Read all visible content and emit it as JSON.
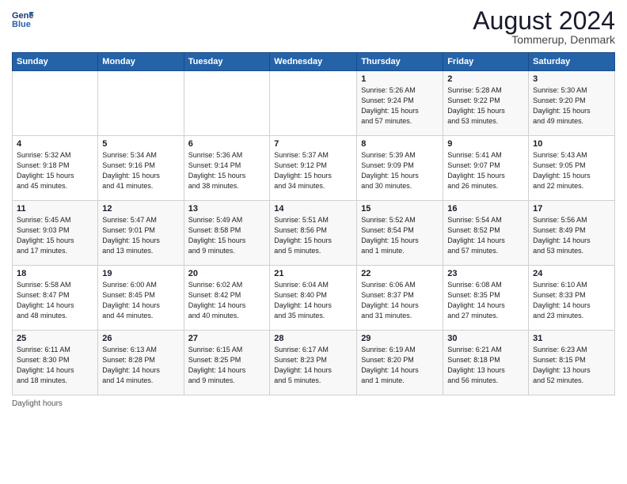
{
  "header": {
    "logo_line1": "General",
    "logo_line2": "Blue",
    "month": "August 2024",
    "location": "Tommerup, Denmark"
  },
  "weekdays": [
    "Sunday",
    "Monday",
    "Tuesday",
    "Wednesday",
    "Thursday",
    "Friday",
    "Saturday"
  ],
  "footer_text": "Daylight hours",
  "weeks": [
    [
      {
        "day": "",
        "info": ""
      },
      {
        "day": "",
        "info": ""
      },
      {
        "day": "",
        "info": ""
      },
      {
        "day": "",
        "info": ""
      },
      {
        "day": "1",
        "info": "Sunrise: 5:26 AM\nSunset: 9:24 PM\nDaylight: 15 hours\nand 57 minutes."
      },
      {
        "day": "2",
        "info": "Sunrise: 5:28 AM\nSunset: 9:22 PM\nDaylight: 15 hours\nand 53 minutes."
      },
      {
        "day": "3",
        "info": "Sunrise: 5:30 AM\nSunset: 9:20 PM\nDaylight: 15 hours\nand 49 minutes."
      }
    ],
    [
      {
        "day": "4",
        "info": "Sunrise: 5:32 AM\nSunset: 9:18 PM\nDaylight: 15 hours\nand 45 minutes."
      },
      {
        "day": "5",
        "info": "Sunrise: 5:34 AM\nSunset: 9:16 PM\nDaylight: 15 hours\nand 41 minutes."
      },
      {
        "day": "6",
        "info": "Sunrise: 5:36 AM\nSunset: 9:14 PM\nDaylight: 15 hours\nand 38 minutes."
      },
      {
        "day": "7",
        "info": "Sunrise: 5:37 AM\nSunset: 9:12 PM\nDaylight: 15 hours\nand 34 minutes."
      },
      {
        "day": "8",
        "info": "Sunrise: 5:39 AM\nSunset: 9:09 PM\nDaylight: 15 hours\nand 30 minutes."
      },
      {
        "day": "9",
        "info": "Sunrise: 5:41 AM\nSunset: 9:07 PM\nDaylight: 15 hours\nand 26 minutes."
      },
      {
        "day": "10",
        "info": "Sunrise: 5:43 AM\nSunset: 9:05 PM\nDaylight: 15 hours\nand 22 minutes."
      }
    ],
    [
      {
        "day": "11",
        "info": "Sunrise: 5:45 AM\nSunset: 9:03 PM\nDaylight: 15 hours\nand 17 minutes."
      },
      {
        "day": "12",
        "info": "Sunrise: 5:47 AM\nSunset: 9:01 PM\nDaylight: 15 hours\nand 13 minutes."
      },
      {
        "day": "13",
        "info": "Sunrise: 5:49 AM\nSunset: 8:58 PM\nDaylight: 15 hours\nand 9 minutes."
      },
      {
        "day": "14",
        "info": "Sunrise: 5:51 AM\nSunset: 8:56 PM\nDaylight: 15 hours\nand 5 minutes."
      },
      {
        "day": "15",
        "info": "Sunrise: 5:52 AM\nSunset: 8:54 PM\nDaylight: 15 hours\nand 1 minute."
      },
      {
        "day": "16",
        "info": "Sunrise: 5:54 AM\nSunset: 8:52 PM\nDaylight: 14 hours\nand 57 minutes."
      },
      {
        "day": "17",
        "info": "Sunrise: 5:56 AM\nSunset: 8:49 PM\nDaylight: 14 hours\nand 53 minutes."
      }
    ],
    [
      {
        "day": "18",
        "info": "Sunrise: 5:58 AM\nSunset: 8:47 PM\nDaylight: 14 hours\nand 48 minutes."
      },
      {
        "day": "19",
        "info": "Sunrise: 6:00 AM\nSunset: 8:45 PM\nDaylight: 14 hours\nand 44 minutes."
      },
      {
        "day": "20",
        "info": "Sunrise: 6:02 AM\nSunset: 8:42 PM\nDaylight: 14 hours\nand 40 minutes."
      },
      {
        "day": "21",
        "info": "Sunrise: 6:04 AM\nSunset: 8:40 PM\nDaylight: 14 hours\nand 35 minutes."
      },
      {
        "day": "22",
        "info": "Sunrise: 6:06 AM\nSunset: 8:37 PM\nDaylight: 14 hours\nand 31 minutes."
      },
      {
        "day": "23",
        "info": "Sunrise: 6:08 AM\nSunset: 8:35 PM\nDaylight: 14 hours\nand 27 minutes."
      },
      {
        "day": "24",
        "info": "Sunrise: 6:10 AM\nSunset: 8:33 PM\nDaylight: 14 hours\nand 23 minutes."
      }
    ],
    [
      {
        "day": "25",
        "info": "Sunrise: 6:11 AM\nSunset: 8:30 PM\nDaylight: 14 hours\nand 18 minutes."
      },
      {
        "day": "26",
        "info": "Sunrise: 6:13 AM\nSunset: 8:28 PM\nDaylight: 14 hours\nand 14 minutes."
      },
      {
        "day": "27",
        "info": "Sunrise: 6:15 AM\nSunset: 8:25 PM\nDaylight: 14 hours\nand 9 minutes."
      },
      {
        "day": "28",
        "info": "Sunrise: 6:17 AM\nSunset: 8:23 PM\nDaylight: 14 hours\nand 5 minutes."
      },
      {
        "day": "29",
        "info": "Sunrise: 6:19 AM\nSunset: 8:20 PM\nDaylight: 14 hours\nand 1 minute."
      },
      {
        "day": "30",
        "info": "Sunrise: 6:21 AM\nSunset: 8:18 PM\nDaylight: 13 hours\nand 56 minutes."
      },
      {
        "day": "31",
        "info": "Sunrise: 6:23 AM\nSunset: 8:15 PM\nDaylight: 13 hours\nand 52 minutes."
      }
    ]
  ]
}
